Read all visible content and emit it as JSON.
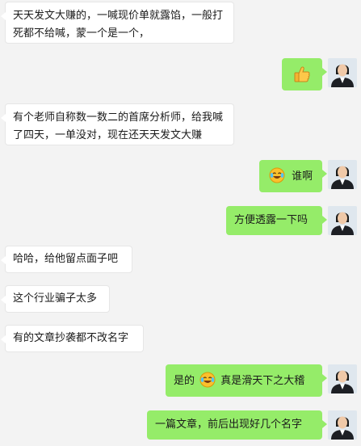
{
  "messages": [
    {
      "side": "left",
      "text": "天天发文大赚的，一喊现价单就露馅，一般打死都不给喊，蒙一个是一个，"
    },
    {
      "side": "right",
      "emoji": "thumbs-up-icon",
      "text": ""
    },
    {
      "side": "left",
      "text": "有个老师自称数一数二的首席分析师，给我喊了四天，一单没对，现在还天天发文大赚"
    },
    {
      "side": "right",
      "emoji": "laughing-crying-icon",
      "text": "谁啊"
    },
    {
      "side": "right",
      "text": "方便透露一下吗"
    },
    {
      "side": "left",
      "text": "哈哈，给他留点面子吧"
    },
    {
      "side": "left",
      "text": "这个行业骗子太多"
    },
    {
      "side": "left",
      "text": "有的文章抄袭都不改名字"
    },
    {
      "side": "right",
      "text_before": "是的",
      "emoji": "laughing-crying-icon",
      "text_after": "真是滑天下之大稽"
    },
    {
      "side": "right",
      "text": "一篇文章，前后出现好几个名字"
    }
  ],
  "colors": {
    "right_bubble": "#95ec69",
    "left_bubble": "#ffffff",
    "background": "#f3f3f3"
  }
}
